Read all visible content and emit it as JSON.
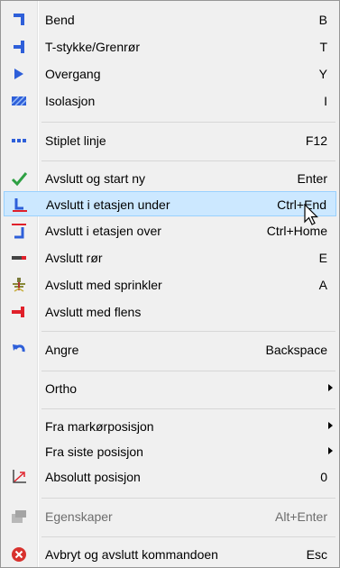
{
  "menu": {
    "items": [
      {
        "label": "Bend",
        "shortcut": "B",
        "icon": "bend-icon"
      },
      {
        "label": "T-stykke/Grenrør",
        "shortcut": "T",
        "icon": "tee-icon"
      },
      {
        "label": "Overgang",
        "shortcut": "Y",
        "icon": "reducer-icon"
      },
      {
        "label": "Isolasjon",
        "shortcut": "I",
        "icon": "insulation-icon"
      },
      {
        "label": "Stiplet linje",
        "shortcut": "F12",
        "icon": "dashed-line-icon"
      },
      {
        "label": "Avslutt og start ny",
        "shortcut": "Enter",
        "icon": "checkmark-icon"
      },
      {
        "label": "Avslutt i etasjen under",
        "shortcut": "Ctrl+End",
        "icon": "floor-below-icon"
      },
      {
        "label": "Avslutt i etasjen over",
        "shortcut": "Ctrl+Home",
        "icon": "floor-above-icon"
      },
      {
        "label": "Avslutt rør",
        "shortcut": "E",
        "icon": "pipe-end-icon"
      },
      {
        "label": "Avslutt med sprinkler",
        "shortcut": "A",
        "icon": "sprinkler-icon"
      },
      {
        "label": "Avslutt med flens",
        "shortcut": "",
        "icon": "flange-icon"
      },
      {
        "label": "Angre",
        "shortcut": "Backspace",
        "icon": "undo-icon"
      },
      {
        "label": "Ortho",
        "shortcut": "",
        "icon": ""
      },
      {
        "label": "Fra markørposisjon",
        "shortcut": "",
        "icon": ""
      },
      {
        "label": "Fra siste posisjon",
        "shortcut": "",
        "icon": ""
      },
      {
        "label": "Absolutt posisjon",
        "shortcut": "0",
        "icon": "axes-icon"
      },
      {
        "label": "Egenskaper",
        "shortcut": "Alt+Enter",
        "icon": "properties-icon"
      },
      {
        "label": "Avbryt og avslutt kommandoen",
        "shortcut": "Esc",
        "icon": "cancel-icon"
      }
    ],
    "highlighted": "Avslutt i etasjen under",
    "disabled": [
      "Egenskaper"
    ],
    "submenus": [
      "Ortho",
      "Fra markørposisjon",
      "Fra siste posisjon"
    ]
  },
  "colors": {
    "highlight_bg": "#cce8ff",
    "highlight_border": "#99d1ff",
    "icon_blue": "#2e5fd9",
    "icon_red": "#e0202a",
    "check_green": "#2ea043"
  }
}
